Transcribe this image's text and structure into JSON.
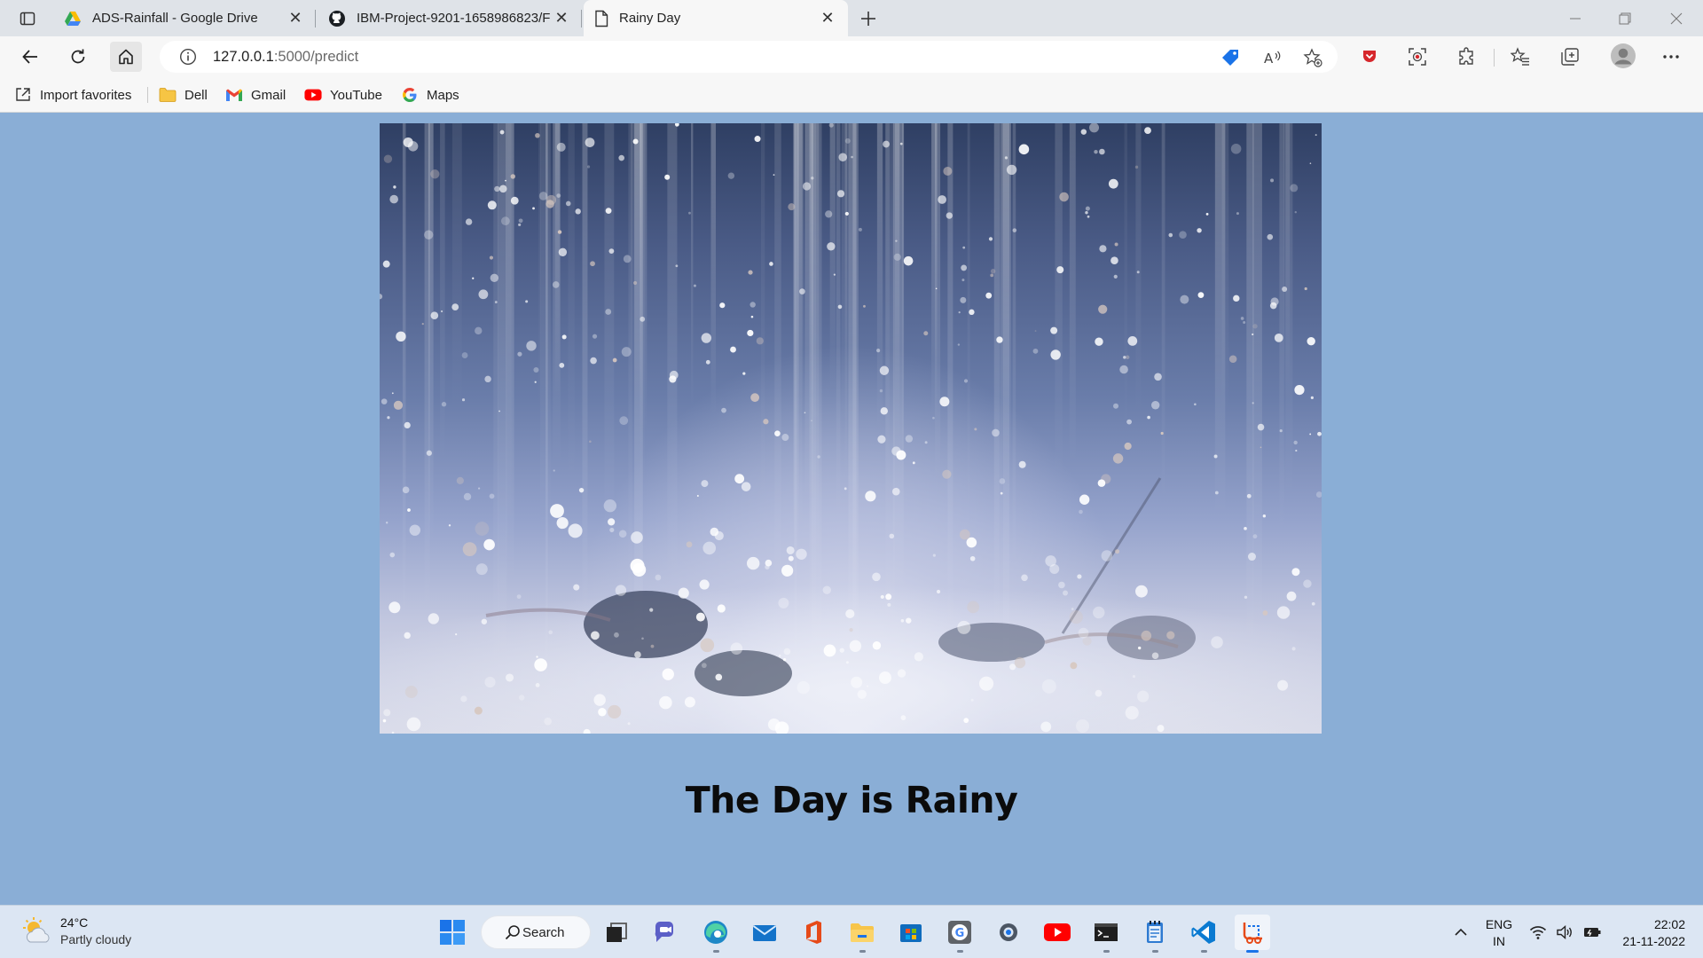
{
  "browser": {
    "tabs": [
      {
        "title": "ADS-Rainfall - Google Drive",
        "icon": "google-drive-icon",
        "active": false
      },
      {
        "title": "IBM-Project-9201-1658986823/F",
        "icon": "github-icon",
        "active": false
      },
      {
        "title": "Rainy Day",
        "icon": "page-icon",
        "active": true
      }
    ],
    "url": {
      "host": "127.0.0.1",
      "path": ":5000/predict"
    }
  },
  "favorites": [
    {
      "label": "Import favorites",
      "icon": "import-icon"
    },
    {
      "label": "Dell",
      "icon": "folder-icon"
    },
    {
      "label": "Gmail",
      "icon": "gmail-icon"
    },
    {
      "label": "YouTube",
      "icon": "youtube-icon"
    },
    {
      "label": "Maps",
      "icon": "google-icon"
    }
  ],
  "page": {
    "heading": "The Day is Rainy",
    "image": "rain-image"
  },
  "taskbar": {
    "weather": {
      "temp": "24°C",
      "condition": "Partly cloudy"
    },
    "search_label": "Search",
    "language": {
      "line1": "ENG",
      "line2": "IN"
    },
    "clock": {
      "time": "22:02",
      "date": "21-11-2022"
    }
  },
  "colors": {
    "page_background": "#8aaed6",
    "taskbar": "#dce6f3",
    "accent": "#1a73e8"
  }
}
